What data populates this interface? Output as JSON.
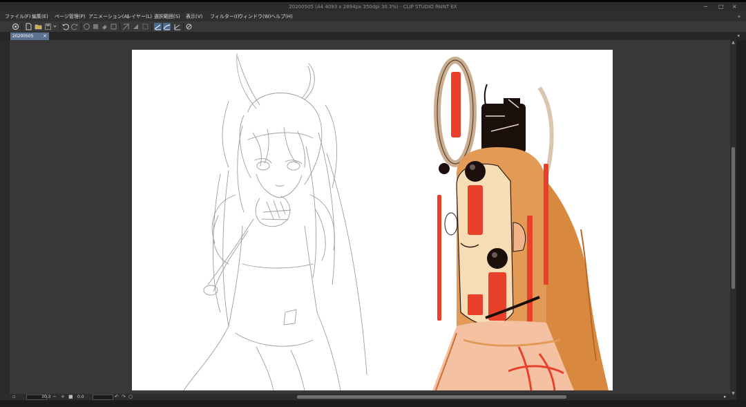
{
  "window": {
    "title": "20200505 (A4 4093 x 2894px 350dpi 30.3%) - CLIP STUDIO PAINT EX",
    "controls": [
      "−",
      "□",
      "×"
    ]
  },
  "menu": {
    "items": [
      "ファイル(F)",
      "編集(E)",
      "ページ管理(P)",
      "アニメーション(A)",
      "レイヤー(L)",
      "選択範囲(S)",
      "表示(V)",
      "フィルター(I)",
      "ウィンドウ(W)",
      "ヘルプ(H)"
    ],
    "expand": "»"
  },
  "toolbar": {
    "icons": [
      "clip-studio-icon",
      "new-file-icon",
      "open-file-icon",
      "save-icon",
      "dropdown-icon",
      "undo-icon",
      "redo-icon",
      "clear-icon",
      "fill-icon",
      "clear-selection-icon",
      "crop-icon",
      "transform-icon",
      "convert-icon",
      "snap-ruler-icon",
      "snap-special-ruler-icon",
      "snap-grid-icon",
      "refresh-icon"
    ],
    "active": [
      "snap-ruler-icon",
      "snap-special-ruler-icon"
    ]
  },
  "document": {
    "tab_name": "20200505",
    "tab_close": "×",
    "tab_menu": "▾"
  },
  "statusbar": {
    "zoom": "30.3",
    "angle": "0.0"
  },
  "colors": {
    "canvas": "#ffffff",
    "workspace": "#383838",
    "active_tab": "#5d7291",
    "tassel_red": "#e8402a",
    "hair_orange": "#d9883f"
  }
}
